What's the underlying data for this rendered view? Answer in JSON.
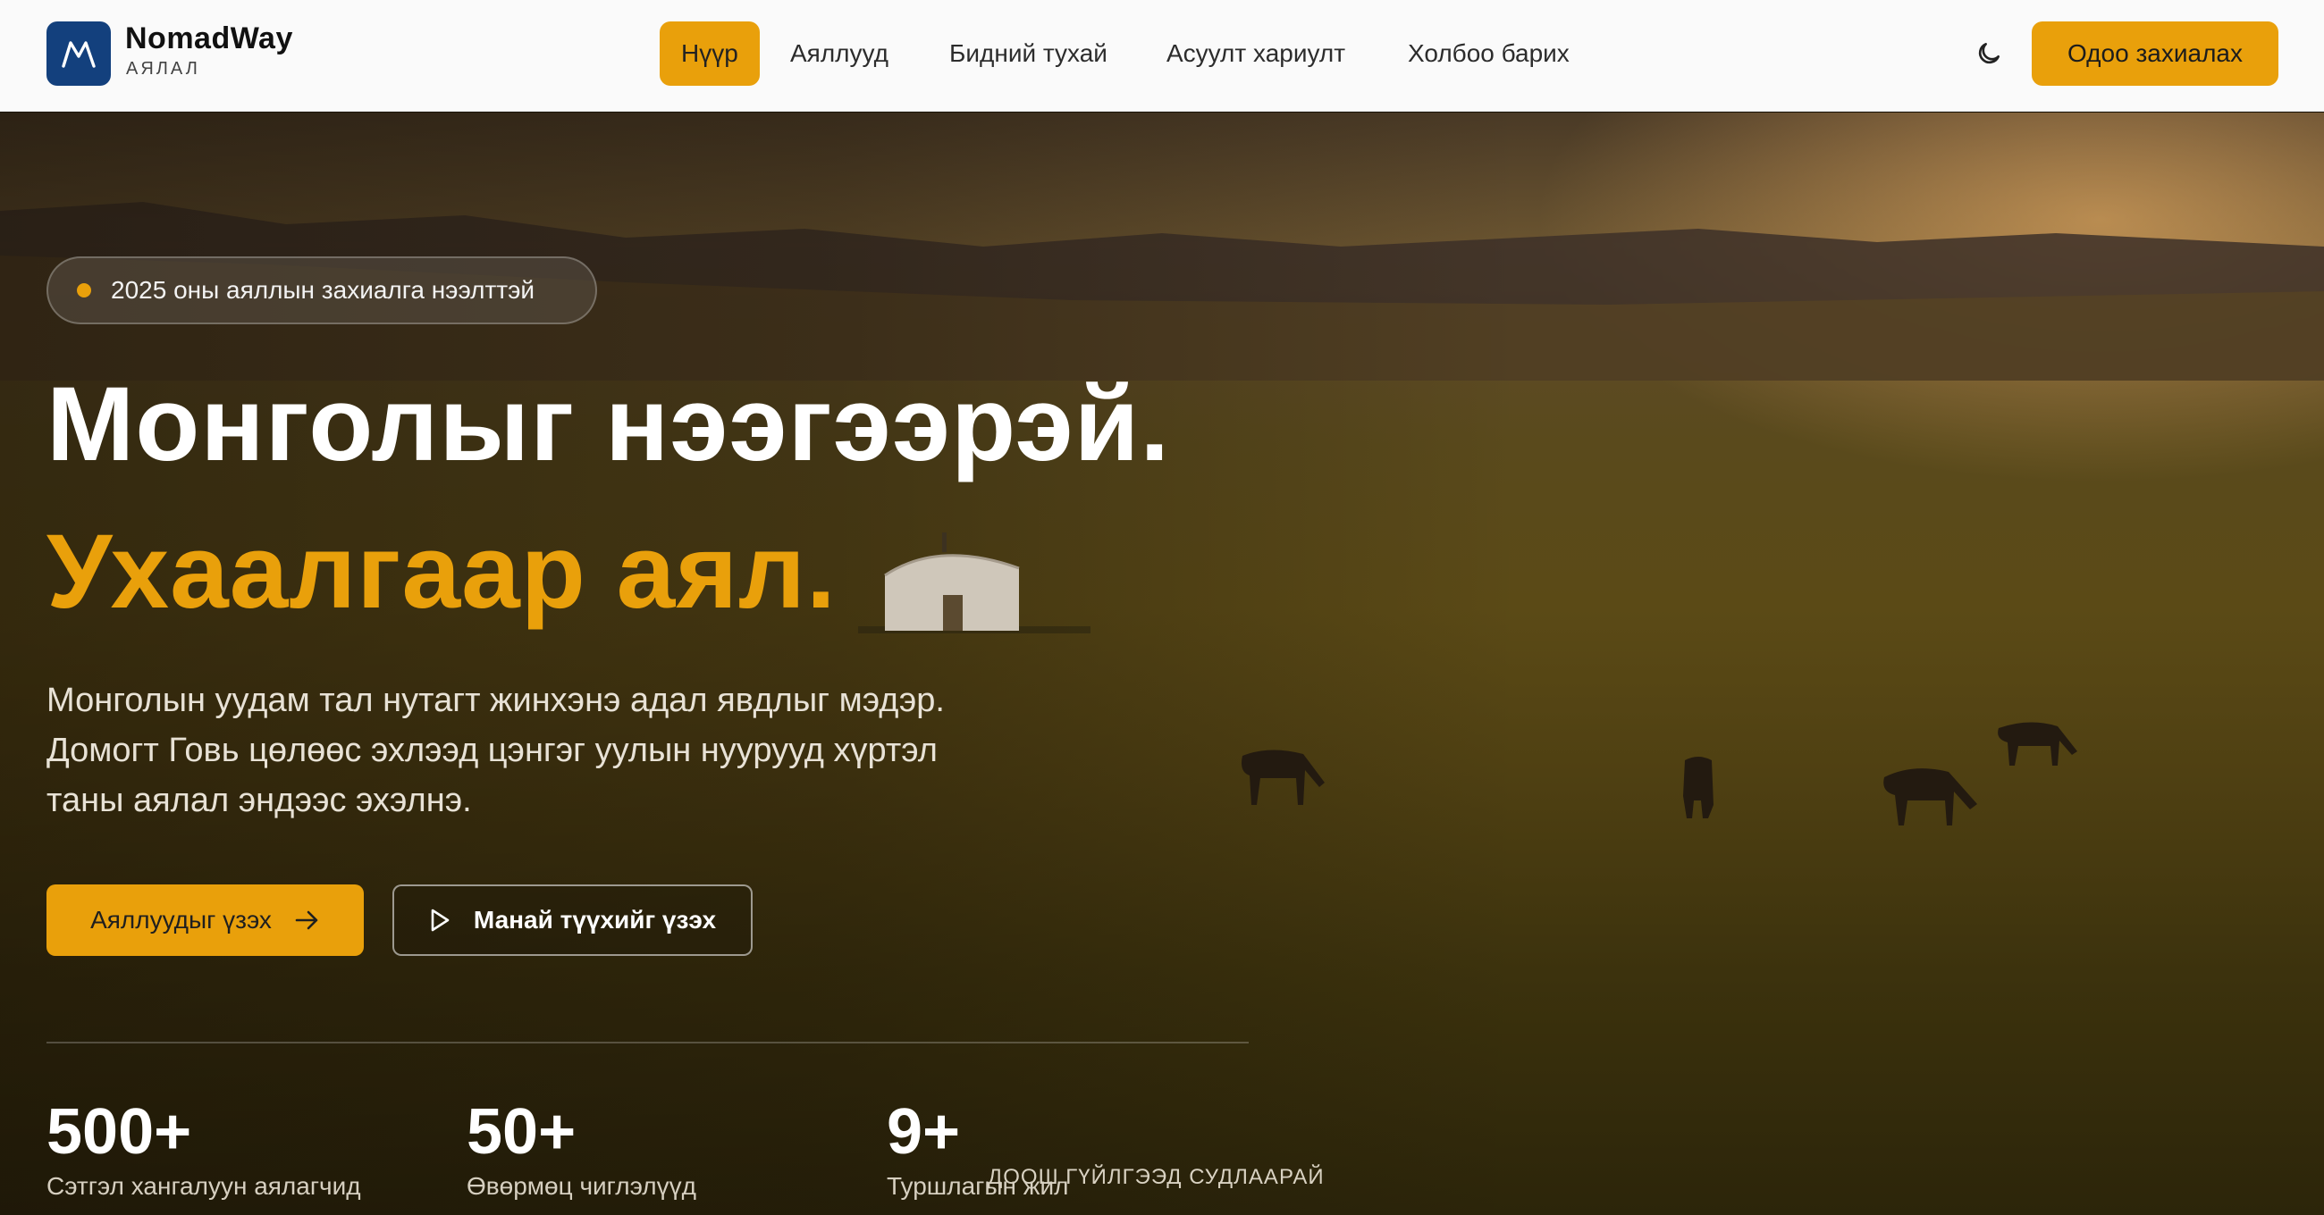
{
  "brand": {
    "name": "NomadWay",
    "subtitle": "АЯЛАЛ"
  },
  "nav": {
    "items": [
      {
        "label": "Нүүр",
        "active": true
      },
      {
        "label": "Аяллууд",
        "active": false
      },
      {
        "label": "Бидний тухай",
        "active": false
      },
      {
        "label": "Асуулт хариулт",
        "active": false
      },
      {
        "label": "Холбоо барих",
        "active": false
      }
    ],
    "cta": "Одоо захиалах"
  },
  "hero": {
    "badge": "2025 оны аяллын захиалга нээлттэй",
    "headline_line1": "Монголыг нээгээрэй.",
    "headline_line2": "Ухаалгаар аял.",
    "description": "Монголын уудам тал нутагт жинхэнэ адал явдлыг мэдэр. Домогт Говь цөлөөс эхлээд цэнгэг уулын нуурууд хүртэл таны аялал эндээс эхэлнэ.",
    "primary_button": "Аяллуудыг үзэх",
    "secondary_button": "Манай түүхийг үзэх",
    "stats": [
      {
        "value": "500+",
        "label": "Сэтгэл хангалуун аялагчид"
      },
      {
        "value": "50+",
        "label": "Өвөрмөц чиглэлүүд"
      },
      {
        "value": "9+",
        "label": "Туршлагын жил"
      }
    ],
    "scroll_hint": "ДООШ ГҮЙЛГЭЭД СУДЛААРАЙ"
  },
  "colors": {
    "accent": "#e9a00b",
    "brand_blue": "#13407d",
    "nav_bg": "#fafafa"
  }
}
